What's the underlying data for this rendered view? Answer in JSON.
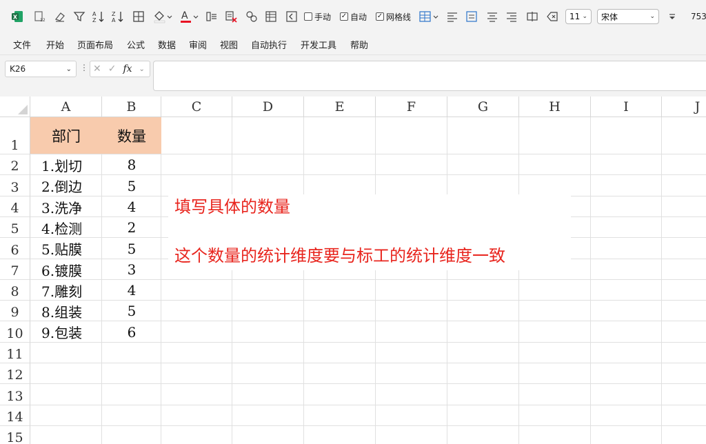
{
  "toolbar": {
    "manual_label": "手动",
    "auto_label": "自动",
    "gridlines_label": "网格线",
    "font_size": "11",
    "font_name": "宋体",
    "zoom_partial": "753"
  },
  "menu": [
    "文件",
    "开始",
    "页面布局",
    "公式",
    "数据",
    "审阅",
    "视图",
    "自动执行",
    "开发工具",
    "帮助"
  ],
  "formula_bar": {
    "name_box": "K26",
    "fx_label": "fx",
    "formula": ""
  },
  "grid": {
    "columns": [
      "A",
      "B",
      "C",
      "D",
      "E",
      "F",
      "G",
      "H",
      "I",
      "J"
    ],
    "rows": [
      "1",
      "2",
      "3",
      "4",
      "5",
      "6",
      "7",
      "8",
      "9",
      "10",
      "11",
      "12",
      "13",
      "14",
      "15"
    ],
    "header": {
      "a": "部门",
      "b": "数量"
    },
    "data": [
      {
        "dept": "1.划切",
        "qty": "8"
      },
      {
        "dept": "2.倒边",
        "qty": "5"
      },
      {
        "dept": "3.洗净",
        "qty": "4"
      },
      {
        "dept": "4.检测",
        "qty": "2"
      },
      {
        "dept": "5.贴膜",
        "qty": "5"
      },
      {
        "dept": "6.镀膜",
        "qty": "3"
      },
      {
        "dept": "7.雕刻",
        "qty": "4"
      },
      {
        "dept": "8.组装",
        "qty": "5"
      },
      {
        "dept": "9.包装",
        "qty": "6"
      }
    ]
  },
  "notes": {
    "line1": "填写具体的数量",
    "line2": "这个数量的统计维度要与标工的统计维度一致",
    "color": "#e8251e"
  },
  "colors": {
    "header_fill": "#f8cbad",
    "excel_green": "#1e7145"
  }
}
